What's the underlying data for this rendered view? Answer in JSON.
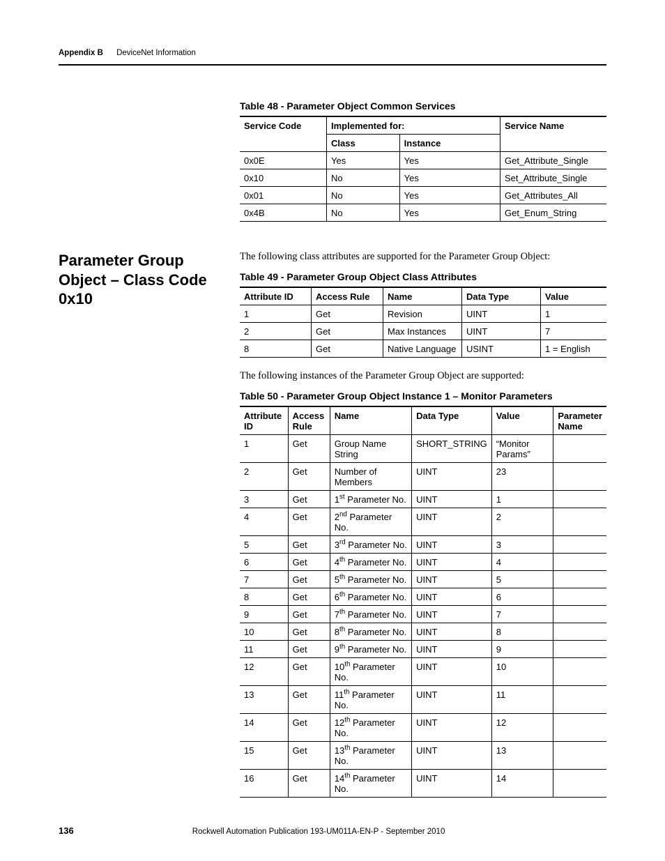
{
  "header": {
    "appendix": "Appendix B",
    "title": "DeviceNet Information"
  },
  "table48": {
    "caption": "Table 48 - Parameter Object Common Services",
    "head": {
      "serviceCode": "Service Code",
      "implementedFor": "Implemented for:",
      "class": "Class",
      "instance": "Instance",
      "serviceName": "Service Name"
    },
    "rows": [
      {
        "code": "0x0E",
        "class": "Yes",
        "instance": "Yes",
        "name": "Get_Attribute_Single"
      },
      {
        "code": "0x10",
        "class": "No",
        "instance": "Yes",
        "name": "Set_Attribute_Single"
      },
      {
        "code": "0x01",
        "class": "No",
        "instance": "Yes",
        "name": "Get_Attributes_All"
      },
      {
        "code": "0x4B",
        "class": "No",
        "instance": "Yes",
        "name": "Get_Enum_String"
      }
    ]
  },
  "section": {
    "title": "Parameter Group Object – Class Code 0x10",
    "intro49": "The following class attributes are supported for the Parameter Group Object:",
    "intro50": "The following instances of the Parameter Group Object are supported:"
  },
  "table49": {
    "caption": "Table 49 - Parameter Group Object Class Attributes",
    "head": {
      "attrId": "Attribute ID",
      "access": "Access Rule",
      "name": "Name",
      "dataType": "Data Type",
      "value": "Value"
    },
    "rows": [
      {
        "id": "1",
        "access": "Get",
        "name": "Revision",
        "type": "UINT",
        "value": "1"
      },
      {
        "id": "2",
        "access": "Get",
        "name": "Max Instances",
        "type": "UINT",
        "value": "7"
      },
      {
        "id": "8",
        "access": "Get",
        "name": "Native Language",
        "type": "USINT",
        "value": "1 = English"
      }
    ]
  },
  "table50": {
    "caption": "Table 50 - Parameter Group Object Instance 1 – Monitor Parameters",
    "head": {
      "attrId": "Attribute ID",
      "access": "Access Rule",
      "name": "Name",
      "dataType": "Data Type",
      "value": "Value",
      "paramName": "Parameter Name"
    },
    "rows": [
      {
        "id": "1",
        "access": "Get",
        "name_plain": "Group Name String",
        "type": "SHORT_STRING",
        "value": "“Monitor Params”",
        "param": ""
      },
      {
        "id": "2",
        "access": "Get",
        "name_plain": "Number of Members",
        "type": "UINT",
        "value": "23",
        "param": ""
      },
      {
        "id": "3",
        "access": "Get",
        "ord": "1",
        "suf": "st",
        "tail": " Parameter No.",
        "type": "UINT",
        "value": "1",
        "param": ""
      },
      {
        "id": "4",
        "access": "Get",
        "ord": "2",
        "suf": "nd",
        "tail": " Parameter No.",
        "type": "UINT",
        "value": "2",
        "param": ""
      },
      {
        "id": "5",
        "access": "Get",
        "ord": "3",
        "suf": "rd",
        "tail": " Parameter No.",
        "type": "UINT",
        "value": "3",
        "param": ""
      },
      {
        "id": "6",
        "access": "Get",
        "ord": "4",
        "suf": "th",
        "tail": " Parameter No.",
        "type": "UINT",
        "value": "4",
        "param": ""
      },
      {
        "id": "7",
        "access": "Get",
        "ord": "5",
        "suf": "th",
        "tail": " Parameter No.",
        "type": "UINT",
        "value": "5",
        "param": ""
      },
      {
        "id": "8",
        "access": "Get",
        "ord": "6",
        "suf": "th",
        "tail": " Parameter No.",
        "type": "UINT",
        "value": "6",
        "param": ""
      },
      {
        "id": "9",
        "access": "Get",
        "ord": "7",
        "suf": "th",
        "tail": " Parameter No.",
        "type": "UINT",
        "value": "7",
        "param": ""
      },
      {
        "id": "10",
        "access": "Get",
        "ord": "8",
        "suf": "th",
        "tail": " Parameter No.",
        "type": "UINT",
        "value": "8",
        "param": ""
      },
      {
        "id": "11",
        "access": "Get",
        "ord": "9",
        "suf": "th",
        "tail": " Parameter No.",
        "type": "UINT",
        "value": "9",
        "param": ""
      },
      {
        "id": "12",
        "access": "Get",
        "ord": "10",
        "suf": "th",
        "tail": " Parameter No.",
        "type": "UINT",
        "value": "10",
        "param": ""
      },
      {
        "id": "13",
        "access": "Get",
        "ord": "11",
        "suf": "th",
        "tail": " Parameter No.",
        "type": "UINT",
        "value": "11",
        "param": ""
      },
      {
        "id": "14",
        "access": "Get",
        "ord": "12",
        "suf": "th",
        "tail": " Parameter No.",
        "type": "UINT",
        "value": "12",
        "param": ""
      },
      {
        "id": "15",
        "access": "Get",
        "ord": "13",
        "suf": "th",
        "tail": " Parameter No.",
        "type": "UINT",
        "value": "13",
        "param": ""
      },
      {
        "id": "16",
        "access": "Get",
        "ord": "14",
        "suf": "th",
        "tail": " Parameter No.",
        "type": "UINT",
        "value": "14",
        "param": ""
      }
    ]
  },
  "footer": {
    "pageNumber": "136",
    "publication": "Rockwell Automation Publication 193-UM011A-EN-P - September 2010"
  }
}
